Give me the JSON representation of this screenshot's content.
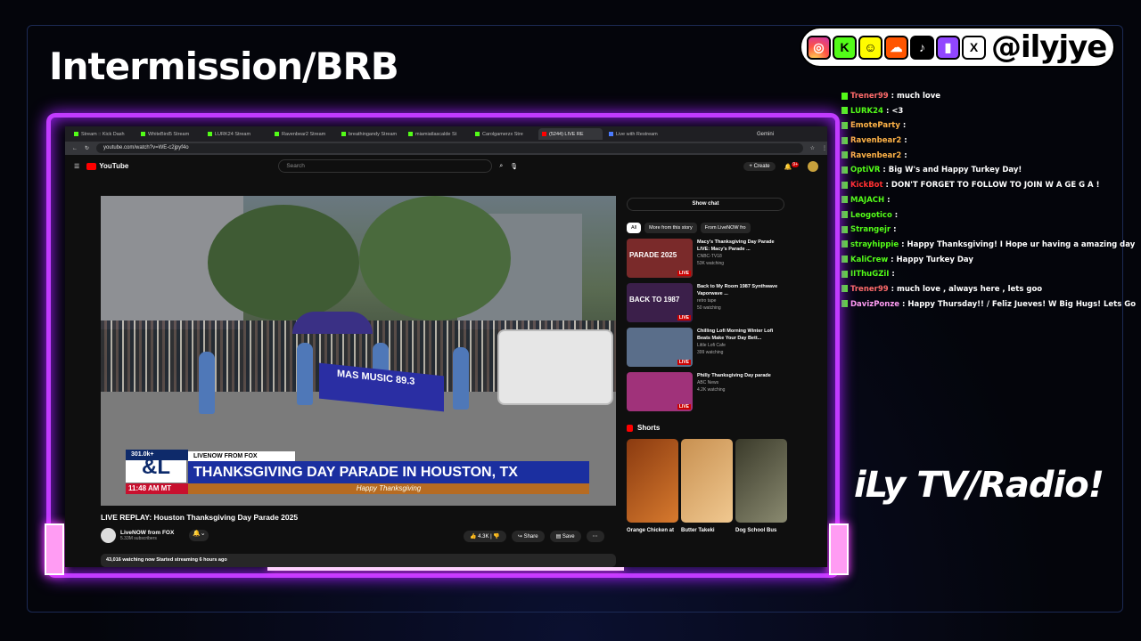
{
  "title": "Intermission/BRB",
  "socials": {
    "icons": [
      "instagram-icon",
      "kick-icon",
      "snapchat-icon",
      "soundcloud-icon",
      "tiktok-icon",
      "twitch-icon",
      "x-icon"
    ],
    "handle": "@ilyjye"
  },
  "chat": [
    {
      "user": "Trener99",
      "msg": "much love",
      "color": "#ff6b6b"
    },
    {
      "user": "LURK24",
      "msg": "<3",
      "color": "#53fc18"
    },
    {
      "user": "EmoteParty",
      "msg": "",
      "color": "#ffb347"
    },
    {
      "user": "Ravenbear2",
      "msg": "",
      "color": "#ffb347"
    },
    {
      "user": "Ravenbear2",
      "msg": "",
      "color": "#ffb347"
    },
    {
      "user": "OptiVR",
      "msg": "Big W's and Happy Turkey Day!",
      "color": "#53fc18"
    },
    {
      "user": "KickBot",
      "msg": "DON'T FORGET TO FOLLOW TO JOIN W A GE G A !",
      "color": "#ff3030"
    },
    {
      "user": "MAJACH",
      "msg": "",
      "color": "#53fc18"
    },
    {
      "user": "Leogotico",
      "msg": "",
      "color": "#53fc18"
    },
    {
      "user": "Strangejr",
      "msg": "",
      "color": "#53fc18"
    },
    {
      "user": "strayhippie",
      "msg": "Happy Thanksgiving! I Hope ur having a amazing day!",
      "color": "#53fc18"
    },
    {
      "user": "KaliCrew",
      "msg": "Happy Turkey Day",
      "color": "#53fc18"
    },
    {
      "user": "IIThuGZiI",
      "msg": "",
      "color": "#53fc18"
    },
    {
      "user": "Trener99",
      "msg": "much love , always here , lets goo",
      "color": "#ff6b6b"
    },
    {
      "user": "DavizPonze",
      "msg": "Happy Thursday!! / Feliz Jueves! W Big Hugs! Lets Goo!!",
      "color": "#ff9cf3"
    }
  ],
  "radio_label": "iLy TV/Radio!",
  "browser": {
    "tabs": [
      "Stream :: Kick Dash",
      "WhiteBird5 Stream",
      "LURK24 Stream",
      "Ravenbear2 Stream",
      "breathingandy Stream",
      "miamiatlascalde St",
      "Carolgamerzx Stre",
      "(5244) LIVE RE",
      "Live with Restream"
    ],
    "gemini": "Gemini",
    "url": "youtube.com/watch?v=WE-c2jpyf4o"
  },
  "youtube": {
    "logo": "YouTube",
    "search_placeholder": "Search",
    "create_label": "Create",
    "notif_count": "9+",
    "video": {
      "viewers": "301.0k+",
      "source": "LIVENOW FROM FOX",
      "headline": "THANKSGIVING DAY PARADE IN HOUSTON, TX",
      "time": "11:48 AM MT",
      "strip": "Happy Thanksgiving",
      "badge": "&L",
      "banner": "MAS MUSIC 89.3"
    },
    "video_title": "LIVE REPLAY: Houston Thanksgiving Day Parade 2025",
    "channel": {
      "name": "LiveNOW from FOX",
      "subs": "5.33M subscribers"
    },
    "actions": {
      "likes": "4.3K",
      "share": "Share",
      "save": "Save"
    },
    "desc": "43,016 watching now  Started streaming 6 hours ago",
    "sidebar": {
      "show_chat": "Show chat",
      "chips": [
        "All",
        "More from this story",
        "From LiveNOW fro"
      ],
      "recs": [
        {
          "title": "Macy's Thanksgiving Day Parade LIVE: Macy's Parade ...",
          "channel": "CNBC-TV18",
          "meta": "53K watching",
          "thumb": "#7a2a2a",
          "overlay": "PARADE 2025"
        },
        {
          "title": "Back to My Room 1987 Synthwave Vaporwave ...",
          "channel": "retro tape",
          "meta": "50 watching",
          "thumb": "#3b1f4a",
          "overlay": "BACK TO 1987"
        },
        {
          "title": "Chilling Lofi Morning Winter Lofi Beats Make Your Day Bett...",
          "channel": "Little Lofi Cafe",
          "meta": "399 watching",
          "thumb": "#5a6e8a",
          "overlay": ""
        },
        {
          "title": "Philly Thanksgiving Day parade",
          "channel": "ABC News",
          "meta": "4.2K watching",
          "thumb": "#a0327a",
          "overlay": ""
        }
      ],
      "shorts_label": "Shorts",
      "shorts": [
        "Orange Chicken at",
        "Butter Takeki",
        "Dog School Bus"
      ]
    }
  }
}
